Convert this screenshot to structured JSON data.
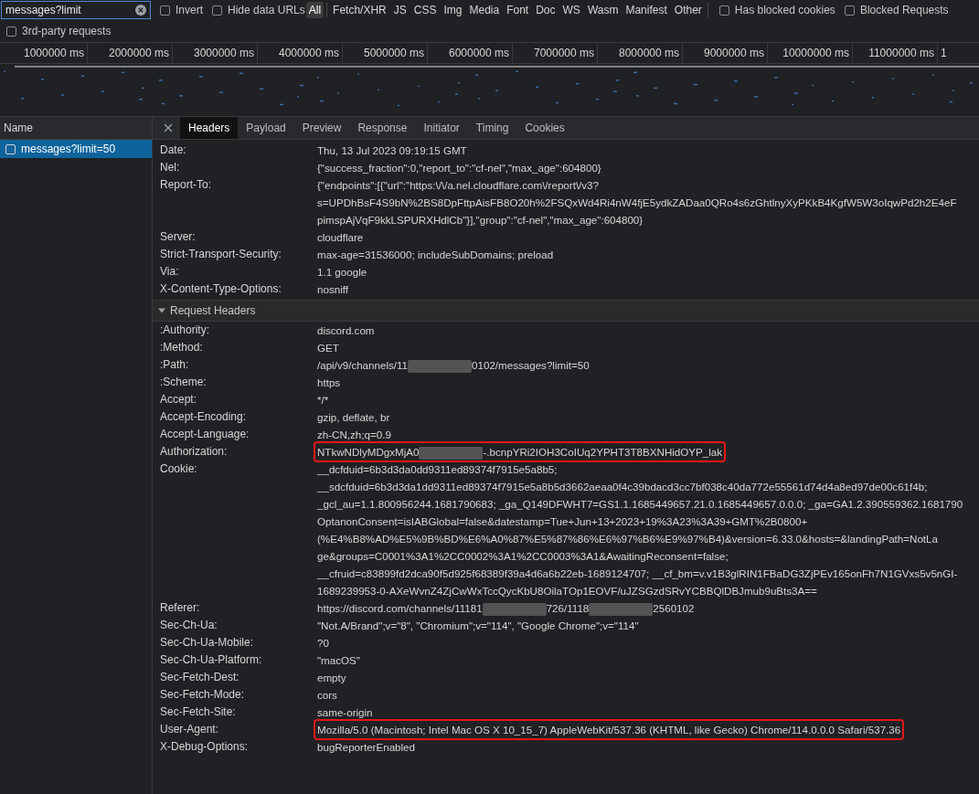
{
  "filter": {
    "value": "messages?limit"
  },
  "checkboxes": [
    {
      "label": "Invert",
      "checked": false
    },
    {
      "label": "Hide data URLs",
      "checked": false
    }
  ],
  "type_filters": [
    {
      "label": "All",
      "selected": true
    },
    {
      "label": "Fetch/XHR",
      "selected": false
    },
    {
      "label": "JS",
      "selected": false
    },
    {
      "label": "CSS",
      "selected": false
    },
    {
      "label": "Img",
      "selected": false
    },
    {
      "label": "Media",
      "selected": false
    },
    {
      "label": "Font",
      "selected": false
    },
    {
      "label": "Doc",
      "selected": false
    },
    {
      "label": "WS",
      "selected": false
    },
    {
      "label": "Wasm",
      "selected": false
    },
    {
      "label": "Manifest",
      "selected": false
    },
    {
      "label": "Other",
      "selected": false
    }
  ],
  "checkboxes_right": [
    {
      "label": "Has blocked cookies",
      "checked": false
    },
    {
      "label": "Blocked Requests",
      "checked": false
    }
  ],
  "third_party": {
    "label": "3rd-party requests",
    "checked": false
  },
  "timeline": {
    "ticks": [
      "1000000 ms",
      "2000000 ms",
      "3000000 ms",
      "4000000 ms",
      "5000000 ms",
      "6000000 ms",
      "7000000 ms",
      "8000000 ms",
      "9000000 ms",
      "10000000 ms",
      "11000000 ms",
      "1"
    ]
  },
  "requests": {
    "column": "Name",
    "rows": [
      {
        "name": "messages?limit=50",
        "selected": true
      }
    ]
  },
  "tabs": [
    {
      "label": "Headers",
      "selected": true
    },
    {
      "label": "Payload",
      "selected": false
    },
    {
      "label": "Preview",
      "selected": false
    },
    {
      "label": "Response",
      "selected": false
    },
    {
      "label": "Initiator",
      "selected": false
    },
    {
      "label": "Timing",
      "selected": false
    },
    {
      "label": "Cookies",
      "selected": false
    }
  ],
  "response_headers": [
    {
      "name": "Date:",
      "lines": [
        "Thu, 13 Jul 2023 09:19:15 GMT"
      ],
      "highlighted": false
    },
    {
      "name": "Nel:",
      "lines": [
        "{\"success_fraction\":0,\"report_to\":\"cf-nel\",\"max_age\":604800}"
      ],
      "highlighted": false
    },
    {
      "name": "Report-To:",
      "lines": [
        "{\"endpoints\":[{\"url\":\"https:\\/\\/a.nel.cloudflare.com\\/report\\/v3?",
        "s=UPDhBsF4S9bN%2BS8DpFttpAisFB8O20h%2FSQxWd4Ri4nW4fjE5ydkZADaa0QRo4s6zGhtlnyXyPKkB4KgfW5W3oIqwPd2h2E4eF",
        "pimspAjVqF9kkLSPURXHdlCb\"}],\"group\":\"cf-nel\",\"max_age\":604800}"
      ],
      "highlighted": false
    },
    {
      "name": "Server:",
      "lines": [
        "cloudflare"
      ],
      "highlighted": false
    },
    {
      "name": "Strict-Transport-Security:",
      "lines": [
        "max-age=31536000; includeSubDomains; preload"
      ],
      "highlighted": false
    },
    {
      "name": "Via:",
      "lines": [
        "1.1 google"
      ],
      "highlighted": false
    },
    {
      "name": "X-Content-Type-Options:",
      "lines": [
        "nosniff"
      ],
      "highlighted": false
    }
  ],
  "request_section": {
    "title": "Request Headers",
    "expanded": true
  },
  "request_headers": [
    {
      "name": ":Authority:",
      "lines": [
        "discord.com"
      ],
      "highlighted": false
    },
    {
      "name": ":Method:",
      "lines": [
        "GET"
      ],
      "highlighted": false
    },
    {
      "name": ":Path:",
      "lines": [
        [
          {
            "kind": "text",
            "text": "/api/v9/channels/11"
          },
          {
            "kind": "redacted"
          },
          {
            "kind": "text",
            "text": "0102/messages?limit=50"
          }
        ]
      ],
      "highlighted": false
    },
    {
      "name": ":Scheme:",
      "lines": [
        "https"
      ],
      "highlighted": false
    },
    {
      "name": "Accept:",
      "lines": [
        "*/*"
      ],
      "highlighted": false
    },
    {
      "name": "Accept-Encoding:",
      "lines": [
        "gzip, deflate, br"
      ],
      "highlighted": false
    },
    {
      "name": "Accept-Language:",
      "lines": [
        "zh-CN,zh;q=0.9"
      ],
      "highlighted": false
    },
    {
      "name": "Authorization:",
      "lines": [
        [
          {
            "kind": "text",
            "text": "NTkwNDlyMDgxMjA0"
          },
          {
            "kind": "redacted"
          },
          {
            "kind": "text",
            "text": "-.bcnpYRi2IOH3CoIUq2YPHT3T8BXNHidOYP_lak"
          }
        ]
      ],
      "highlighted": true
    },
    {
      "name": "Cookie:",
      "lines": [
        "__dcfduid=6b3d3da0dd9311ed89374f7915e5a8b5;",
        "__sdcfduid=6b3d3da1dd9311ed89374f7915e5a8b5d3662aeaa0f4c39bdacd3cc7bf038c40da772e55561d74d4a8ed97de00c61f4b;",
        "_gcl_au=1.1.800956244.1681790683; _ga_Q149DFWHT7=GS1.1.1685449657.21.0.1685449657.0.0.0; _ga=GA1.2.390559362.1681790",
        "OptanonConsent=isIABGlobal=false&datestamp=Tue+Jun+13+2023+19%3A23%3A39+GMT%2B0800+",
        "(%E4%B8%AD%E5%9B%BD%E6%A0%87%E5%87%86%E6%97%B6%E9%97%B4)&version=6.33.0&hosts=&landingPath=NotLa",
        "ge&groups=C0001%3A1%2CC0002%3A1%2CC0003%3A1&AwaitingReconsent=false;",
        "__cfruid=c83899fd2dca90f5d925f68389f39a4d6a6b22eb-1689124707; __cf_bm=v.v1B3glRIN1FBaDG3ZjPEv165onFh7N1GVxs5v5nGI-",
        "1689239953-0-AXeWvnZ4ZjCwWxTccQycKbU8OilaTOp1EOVF/uJZSGzdSRvYCBBQlDBJmub9uBts3A=="
      ],
      "highlighted": false
    },
    {
      "name": "Referer:",
      "lines": [
        [
          {
            "kind": "text",
            "text": "https://discord.com/channels/11181"
          },
          {
            "kind": "redacted"
          },
          {
            "kind": "text",
            "text": "726/1118"
          },
          {
            "kind": "redacted"
          },
          {
            "kind": "text",
            "text": "2560102"
          }
        ]
      ],
      "highlighted": false
    },
    {
      "name": "Sec-Ch-Ua:",
      "lines": [
        "\"Not.A/Brand\";v=\"8\", \"Chromium\";v=\"114\", \"Google Chrome\";v=\"114\""
      ],
      "highlighted": false
    },
    {
      "name": "Sec-Ch-Ua-Mobile:",
      "lines": [
        "?0"
      ],
      "highlighted": false
    },
    {
      "name": "Sec-Ch-Ua-Platform:",
      "lines": [
        "\"macOS\""
      ],
      "highlighted": false
    },
    {
      "name": "Sec-Fetch-Dest:",
      "lines": [
        "empty"
      ],
      "highlighted": false
    },
    {
      "name": "Sec-Fetch-Mode:",
      "lines": [
        "cors"
      ],
      "highlighted": false
    },
    {
      "name": "Sec-Fetch-Site:",
      "lines": [
        "same-origin"
      ],
      "highlighted": false
    },
    {
      "name": "User-Agent:",
      "lines": [
        "Mozilla/5.0 (Macintosh; Intel Mac OS X 10_15_7) AppleWebKit/537.36 (KHTML, like Gecko) Chrome/114.0.0.0 Safari/537.36"
      ],
      "highlighted": true
    },
    {
      "name": "X-Debug-Options:",
      "lines": [
        "bugReporterEnabled"
      ],
      "highlighted": false
    }
  ]
}
